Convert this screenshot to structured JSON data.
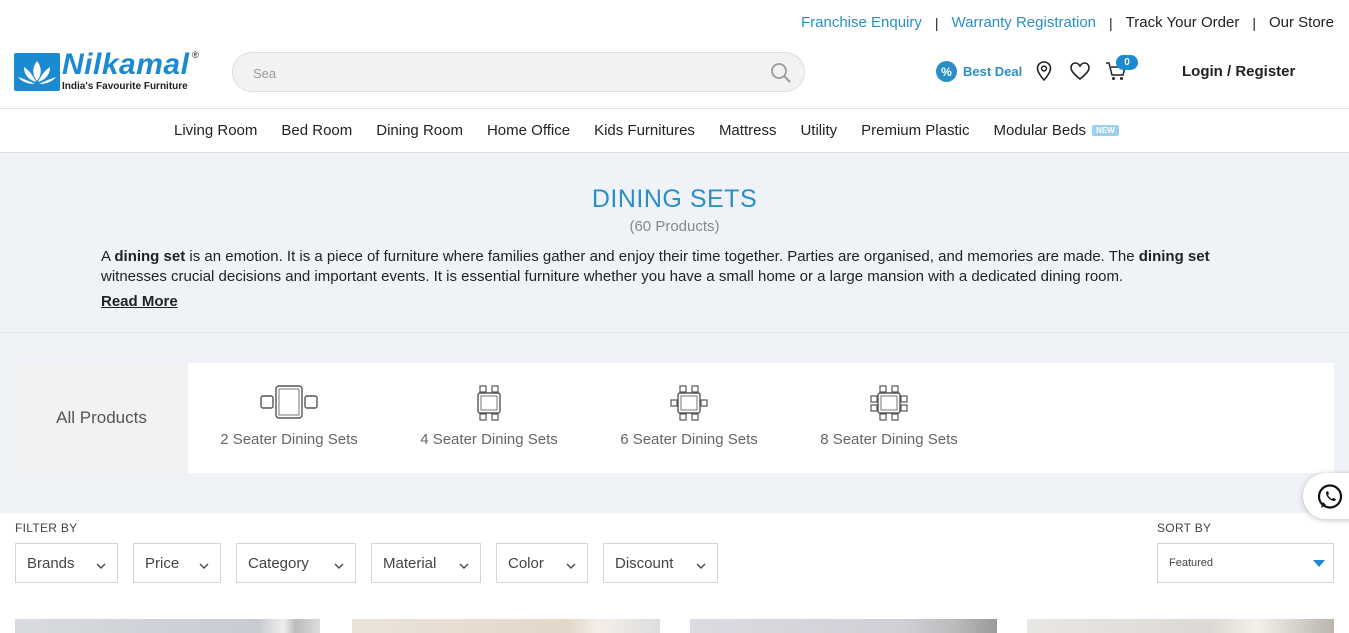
{
  "top_links": [
    {
      "label": "Franchise Enquiry",
      "style": "blue"
    },
    {
      "label": "Warranty Registration",
      "style": "blue"
    },
    {
      "label": "Track Your Order",
      "style": "dark"
    },
    {
      "label": "Our Store",
      "style": "dark"
    }
  ],
  "brand": {
    "name": "Nilkamal",
    "reg": "®",
    "tagline": "India's Favourite Furniture"
  },
  "search": {
    "value": "",
    "placeholder": "Sea",
    "icon": "search-icon"
  },
  "header": {
    "best_deal_label": "Best Deal",
    "best_deal_icon": "%",
    "cart_count": "0",
    "login_label": "Login / Register"
  },
  "nav": {
    "items": [
      "Living Room",
      "Bed Room",
      "Dining Room",
      "Home Office",
      "Kids Furnitures",
      "Mattress",
      "Utility",
      "Premium Plastic",
      "Modular Beds"
    ],
    "new_badge": "NEW"
  },
  "category": {
    "title": "DINING SETS",
    "count": "(60 Products)",
    "desc_parts": [
      "A ",
      "dining set",
      " is an emotion. It is a piece of furniture where families gather and enjoy their time together. Parties are organised, and memories are made. The ",
      "dining set",
      " witnesses crucial decisions and important events. It is essential furniture whether you have a small home or a large mansion with a dedicated dining room."
    ],
    "read_more": "Read More"
  },
  "subcategories": {
    "all_label": "All Products",
    "tiles": [
      "2 Seater Dining Sets",
      "4 Seater Dining Sets",
      "6 Seater Dining Sets",
      "8 Seater Dining Sets"
    ]
  },
  "filters": {
    "title": "FILTER BY",
    "items": [
      "Brands",
      "Price",
      "Category",
      "Material",
      "Color",
      "Discount"
    ]
  },
  "sort": {
    "title": "SORT BY",
    "selected": "Featured"
  },
  "colors": {
    "accent": "#2a8fc7",
    "brand": "#1b8ad0",
    "intro_bg": "#eff3f8"
  }
}
